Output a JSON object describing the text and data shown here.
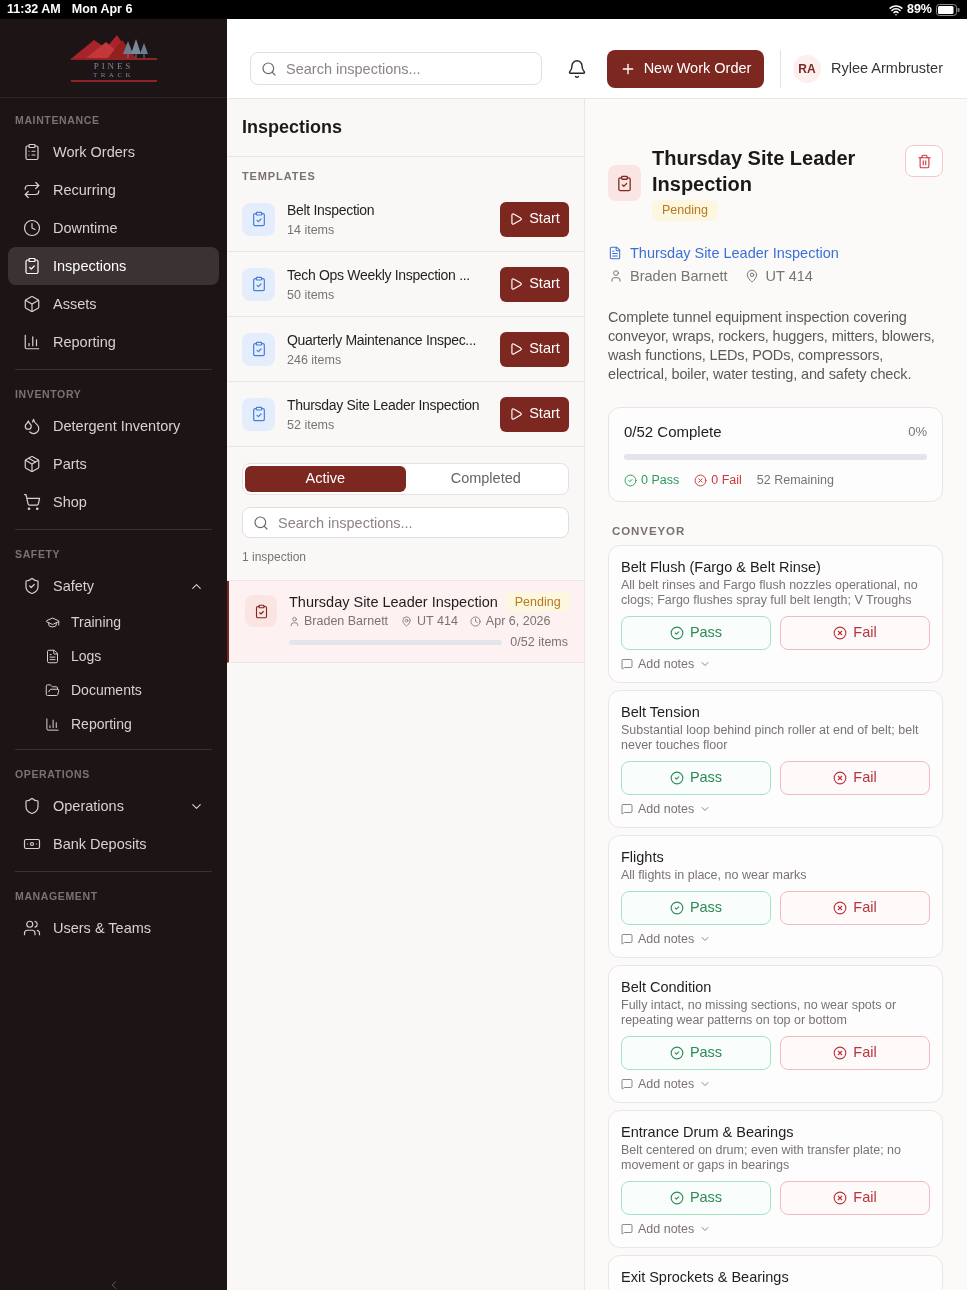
{
  "status_bar": {
    "time": "11:32 AM",
    "date": "Mon Apr 6",
    "battery": "89%"
  },
  "sidebar": {
    "logo": {
      "line_1": "PINES",
      "line_2": "TRACK"
    },
    "sections": [
      {
        "title": "MAINTENANCE",
        "items": [
          {
            "label": "Work Orders",
            "kind": "link",
            "selected": false
          },
          {
            "label": "Recurring",
            "kind": "link",
            "selected": false
          },
          {
            "label": "Downtime",
            "kind": "link",
            "selected": false
          },
          {
            "label": "Inspections",
            "kind": "link",
            "selected": true
          },
          {
            "label": "Assets",
            "kind": "link",
            "selected": false
          },
          {
            "label": "Reporting",
            "kind": "link",
            "selected": false
          }
        ]
      },
      {
        "title": "INVENTORY",
        "items": [
          {
            "label": "Detergent Inventory",
            "kind": "link",
            "selected": false
          },
          {
            "label": "Parts",
            "kind": "link",
            "selected": false
          },
          {
            "label": "Shop",
            "kind": "link",
            "selected": false
          }
        ]
      },
      {
        "title": "SAFETY",
        "items": [
          {
            "label": "Safety",
            "kind": "group",
            "selected": false,
            "expanded": true,
            "children": [
              {
                "label": "Training",
                "selected": false
              },
              {
                "label": "Logs",
                "selected": false
              },
              {
                "label": "Documents",
                "selected": false
              },
              {
                "label": "Reporting",
                "selected": false
              }
            ]
          }
        ]
      },
      {
        "title": "OPERATIONS",
        "items": [
          {
            "label": "Operations",
            "kind": "group",
            "selected": false,
            "expanded": false
          },
          {
            "label": "Bank Deposits",
            "kind": "link",
            "selected": false
          }
        ]
      },
      {
        "title": "MANAGEMENT",
        "items": [
          {
            "label": "Users & Teams",
            "kind": "link",
            "selected": false
          }
        ]
      }
    ]
  },
  "header": {
    "search": {
      "placeholder": "Search inspections..."
    },
    "new_button": "New Work Order",
    "user": {
      "initials": "RA",
      "name": "Rylee Armbruster"
    }
  },
  "list_panel": {
    "title": "Inspections",
    "templates": {
      "heading": "TEMPLATES",
      "items": [
        {
          "name": "Belt Inspection",
          "count": "14 items",
          "button": "Start"
        },
        {
          "name": "Tech Ops Weekly Inspection ...",
          "count": "50 items",
          "button": "Start"
        },
        {
          "name": "Quarterly Maintenance Inspec...",
          "count": "246 items",
          "button": "Start"
        },
        {
          "name": "Thursday Site Leader Inspection",
          "count": "52 items",
          "button": "Start"
        }
      ]
    },
    "tabs": [
      {
        "label": "Active",
        "selected": true
      },
      {
        "label": "Completed",
        "selected": false
      }
    ],
    "search": {
      "placeholder": "Search inspections..."
    },
    "result_count": "1 inspection",
    "inspections": [
      {
        "title": "Thursday Site Leader Inspection",
        "status": "Pending",
        "assignee": "Braden Barnett",
        "location": "UT 414",
        "date": "Apr 6, 2026",
        "progress": "0/52 items",
        "level": 0,
        "selected": true
      }
    ]
  },
  "detail": {
    "title": "Thursday Site Leader Inspection",
    "status": "Pending",
    "template_link": "Thursday Site Leader Inspection",
    "assignee": "Braden Barnett",
    "location": "UT 414",
    "description": "Complete tunnel equipment inspection covering conveyor, wraps, rockers, huggers, mitters, blowers, wash functions, LEDs, PODs, compressors, electrical, boiler, water testing, and safety check.",
    "progress": {
      "title": "0/52 Complete",
      "percent": "0%",
      "level": 0,
      "pass": "0 Pass",
      "fail": "0 Fail",
      "remaining": "52 Remaining"
    },
    "sections": [
      {
        "title": "CONVEYOR",
        "items": [
          {
            "name": "Belt Flush (Fargo & Belt Rinse)",
            "description": "All belt rinses and Fargo flush nozzles operational, no clogs; Fargo flushes spray full belt length; V Troughs",
            "pass": {
              "label": "Pass",
              "selected": false
            },
            "fail": {
              "label": "Fail",
              "selected": false
            },
            "notes": "Add notes"
          },
          {
            "name": "Belt Tension",
            "description": "Substantial loop behind pinch roller at end of belt; belt never touches floor",
            "pass": {
              "label": "Pass",
              "selected": false
            },
            "fail": {
              "label": "Fail",
              "selected": false
            },
            "notes": "Add notes"
          },
          {
            "name": "Flights",
            "description": "All flights in place, no wear marks",
            "pass": {
              "label": "Pass",
              "selected": false
            },
            "fail": {
              "label": "Fail",
              "selected": false
            },
            "notes": "Add notes"
          },
          {
            "name": "Belt Condition",
            "description": "Fully intact, no missing sections, no wear spots or repeating wear patterns on top or bottom",
            "pass": {
              "label": "Pass",
              "selected": false
            },
            "fail": {
              "label": "Fail",
              "selected": false
            },
            "notes": "Add notes"
          },
          {
            "name": "Entrance Drum & Bearings",
            "description": "Belt centered on drum; even with transfer plate; no movement or gaps in bearings",
            "pass": {
              "label": "Pass",
              "selected": false
            },
            "fail": {
              "label": "Fail",
              "selected": false
            },
            "notes": "Add notes"
          },
          {
            "name": "Exit Sprockets & Bearings"
          }
        ]
      }
    ]
  }
}
